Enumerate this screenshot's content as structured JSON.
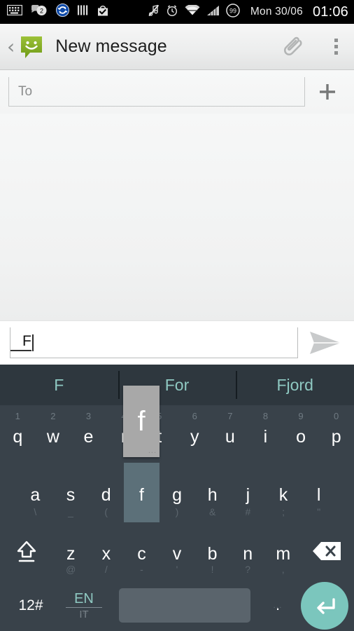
{
  "statusbar": {
    "icons_left": [
      "keyboard-icon",
      "messages-badge-icon",
      "sync-icon",
      "barcode-icon",
      "play-store-update-icon"
    ],
    "messages_badge_count": "2",
    "icons_right": [
      "mute-icon",
      "alarm-icon",
      "wifi-icon",
      "signal-icon",
      "battery-icon"
    ],
    "battery_percent": "99",
    "date": "Mon 30/06",
    "time": "01:06"
  },
  "appbar": {
    "back_label": "‹",
    "app_icon": "messaging-smiley-icon",
    "title": "New message",
    "attach_label": "attach-icon",
    "overflow_label": "overflow-menu-icon"
  },
  "recipient": {
    "placeholder": "To",
    "value": "",
    "add_contact_label": "+"
  },
  "compose": {
    "value": "F",
    "send_label": "send-icon"
  },
  "keyboard": {
    "suggestions": [
      "F",
      "For",
      "Fjord"
    ],
    "popup_key": "f",
    "row1": [
      {
        "num": "1",
        "main": "q"
      },
      {
        "num": "2",
        "main": "w"
      },
      {
        "num": "3",
        "main": "e"
      },
      {
        "num": "4",
        "main": "r"
      },
      {
        "num": "5",
        "main": "t"
      },
      {
        "num": "6",
        "main": "y"
      },
      {
        "num": "7",
        "main": "u"
      },
      {
        "num": "8",
        "main": "i"
      },
      {
        "num": "9",
        "main": "o"
      },
      {
        "num": "0",
        "main": "p"
      }
    ],
    "row2": [
      {
        "main": "a",
        "sub": "\\"
      },
      {
        "main": "s",
        "sub": "_"
      },
      {
        "main": "d",
        "sub": "("
      },
      {
        "main": "f",
        "sub": ")"
      },
      {
        "main": "g",
        "sub": ")"
      },
      {
        "main": "h",
        "sub": "&"
      },
      {
        "main": "j",
        "sub": "#"
      },
      {
        "main": "k",
        "sub": ";"
      },
      {
        "main": "l",
        "sub": "\""
      }
    ],
    "row3": [
      {
        "main": "z",
        "sub": "@"
      },
      {
        "main": "x",
        "sub": "/"
      },
      {
        "main": "c",
        "sub": "-"
      },
      {
        "main": "v",
        "sub": "'"
      },
      {
        "main": "b",
        "sub": "!"
      },
      {
        "main": "n",
        "sub": "?"
      },
      {
        "main": "m",
        "sub": ","
      }
    ],
    "shift_label": "shift-icon",
    "backspace_label": "backspace-icon",
    "symbols_label": "12#",
    "lang_primary": "EN",
    "lang_secondary": "IT",
    "period_label": ".",
    "enter_label": "enter-icon",
    "accent_color": "#7bc6bd",
    "suggestion_color": "#8fc9c2",
    "background_color": "#39424a"
  }
}
